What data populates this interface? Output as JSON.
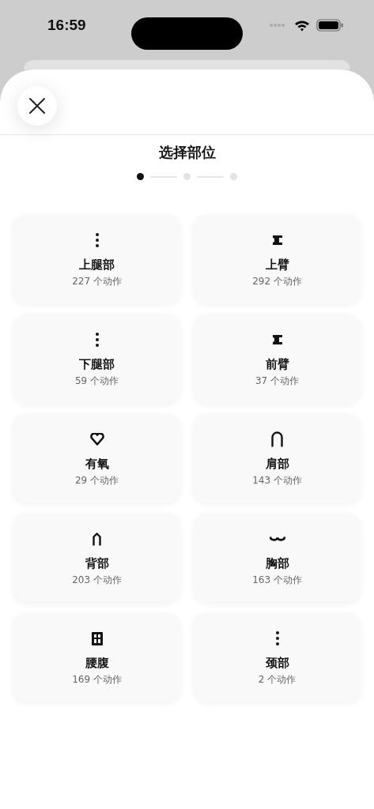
{
  "status_bar": {
    "time": "16:59"
  },
  "title": "选择部位",
  "steps": [
    {
      "selected": true
    },
    {
      "selected": false
    },
    {
      "selected": false
    }
  ],
  "parts": [
    {
      "name": "上腿部",
      "count": "227 个动作",
      "kind": "dots"
    },
    {
      "name": "上臂",
      "count": "292 个动作",
      "kind": "arm"
    },
    {
      "name": "下腿部",
      "count": "59 个动作",
      "kind": "dots"
    },
    {
      "name": "前臂",
      "count": "37 个动作",
      "kind": "arm"
    },
    {
      "name": "有氧",
      "count": "29 个动作",
      "kind": "heart"
    },
    {
      "name": "肩部",
      "count": "143 个动作",
      "kind": "arch"
    },
    {
      "name": "背部",
      "count": "203 个动作",
      "kind": "back"
    },
    {
      "name": "胸部",
      "count": "163 个动作",
      "kind": "chest"
    },
    {
      "name": "腰腹",
      "count": "169 个动作",
      "kind": "abs"
    },
    {
      "name": "颈部",
      "count": "2 个动作",
      "kind": "dots"
    }
  ]
}
